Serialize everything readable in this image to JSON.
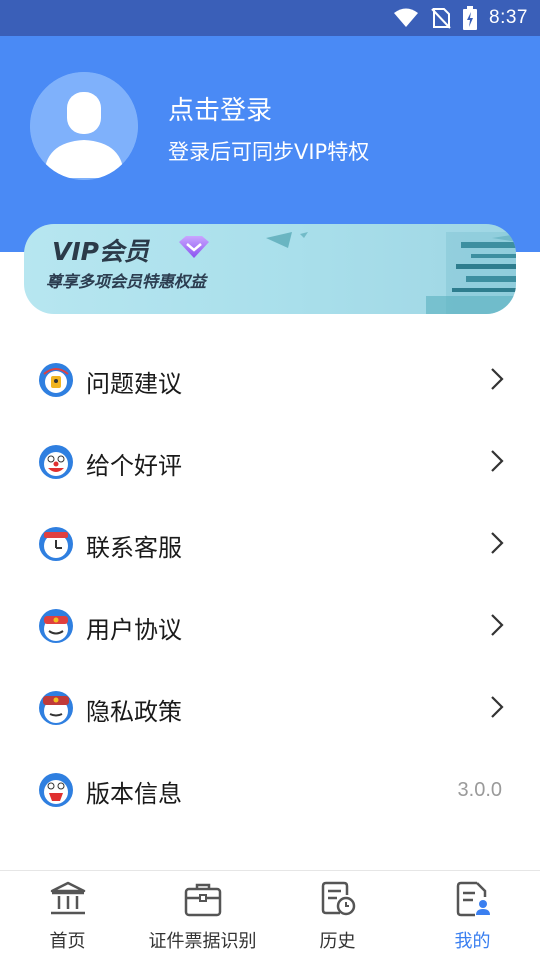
{
  "status_bar": {
    "time": "8:37",
    "icons": [
      "wifi-icon",
      "no-sim-icon",
      "battery-charging-icon"
    ]
  },
  "profile": {
    "title": "点击登录",
    "subtitle": "登录后可同步VIP特权",
    "avatar_icon": "default-avatar-icon"
  },
  "vip": {
    "title": "VIP会员",
    "subtitle": "尊享多项会员特惠权益",
    "badge_icon": "diamond-icon"
  },
  "menu": {
    "items": [
      {
        "label": "问题建议",
        "icon": "feedback-icon"
      },
      {
        "label": "给个好评",
        "icon": "rate-icon"
      },
      {
        "label": "联系客服",
        "icon": "customer-service-icon"
      },
      {
        "label": "用户协议",
        "icon": "user-agreement-icon"
      },
      {
        "label": "隐私政策",
        "icon": "privacy-policy-icon"
      },
      {
        "label": "版本信息",
        "icon": "version-icon",
        "value": "3.0.0"
      }
    ]
  },
  "tabbar": {
    "tabs": [
      {
        "label": "首页",
        "icon": "home-building-icon"
      },
      {
        "label": "证件票据识别",
        "icon": "briefcase-icon"
      },
      {
        "label": "历史",
        "icon": "history-icon"
      },
      {
        "label": "我的",
        "icon": "profile-document-icon",
        "active": true
      }
    ]
  },
  "colors": {
    "header_blue": "#4a8af5",
    "status_bar": "#3a5fb8",
    "active_tab": "#3a7ff0",
    "vip_card": "#b7e6f0"
  }
}
